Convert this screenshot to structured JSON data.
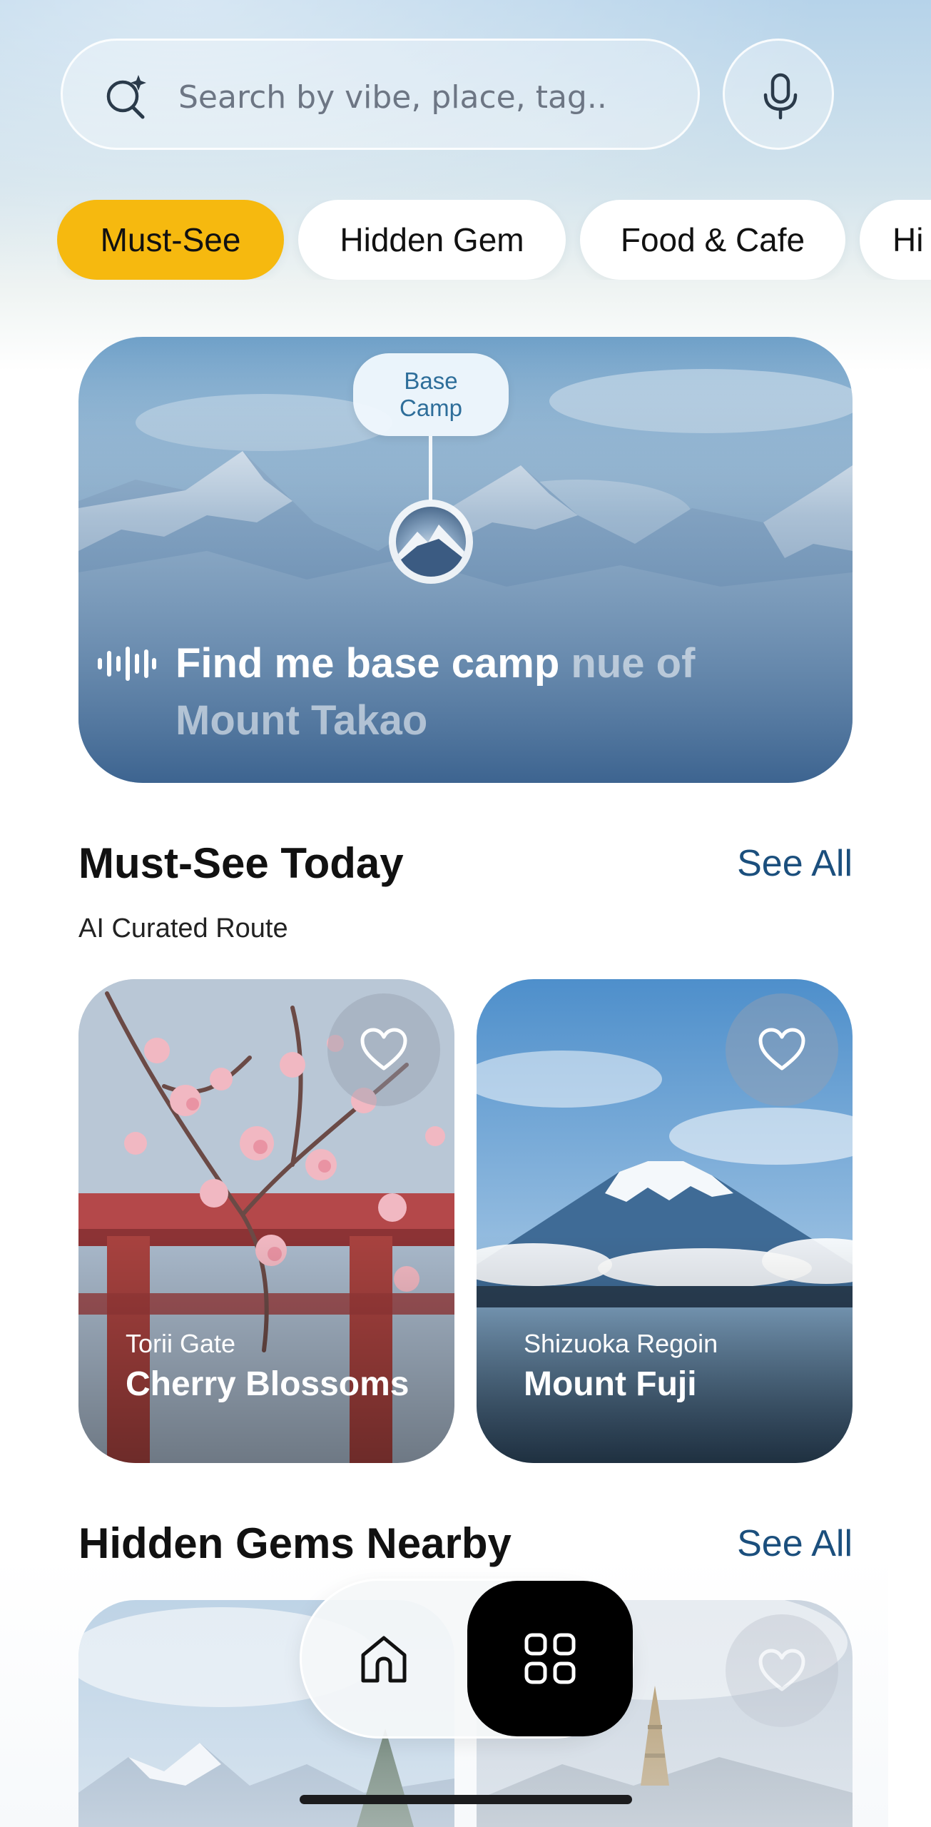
{
  "search": {
    "placeholder": "Search by vibe, place, tag.."
  },
  "chips": [
    {
      "label": "Must-See",
      "active": true
    },
    {
      "label": "Hidden Gem",
      "active": false
    },
    {
      "label": "Food & Cafe",
      "active": false
    },
    {
      "label": "Hi",
      "active": false
    }
  ],
  "hero": {
    "pin_label_line1": "Base",
    "pin_label_line2": "Camp",
    "query_spoken": "Find me base camp",
    "query_pending_inline": " nue of",
    "query_pending_line2": "Mount Takao"
  },
  "must_see": {
    "title": "Must-See Today",
    "see_all": "See All",
    "subtitle": "AI Curated Route",
    "cards": [
      {
        "subtitle": "Torii Gate",
        "title": "Cherry Blossoms"
      },
      {
        "subtitle": "Shizuoka Regoin",
        "title": "Mount Fuji"
      }
    ]
  },
  "hidden_gems": {
    "title": "Hidden Gems Nearby",
    "see_all": "See All"
  },
  "colors": {
    "accent": "#f6b90f",
    "link": "#1b4f7d",
    "pin_text": "#2e6e9a"
  },
  "icons": [
    "search-sparkle-icon",
    "microphone-icon",
    "voice-wave-icon",
    "heart-icon",
    "home-icon",
    "grid-icon"
  ]
}
